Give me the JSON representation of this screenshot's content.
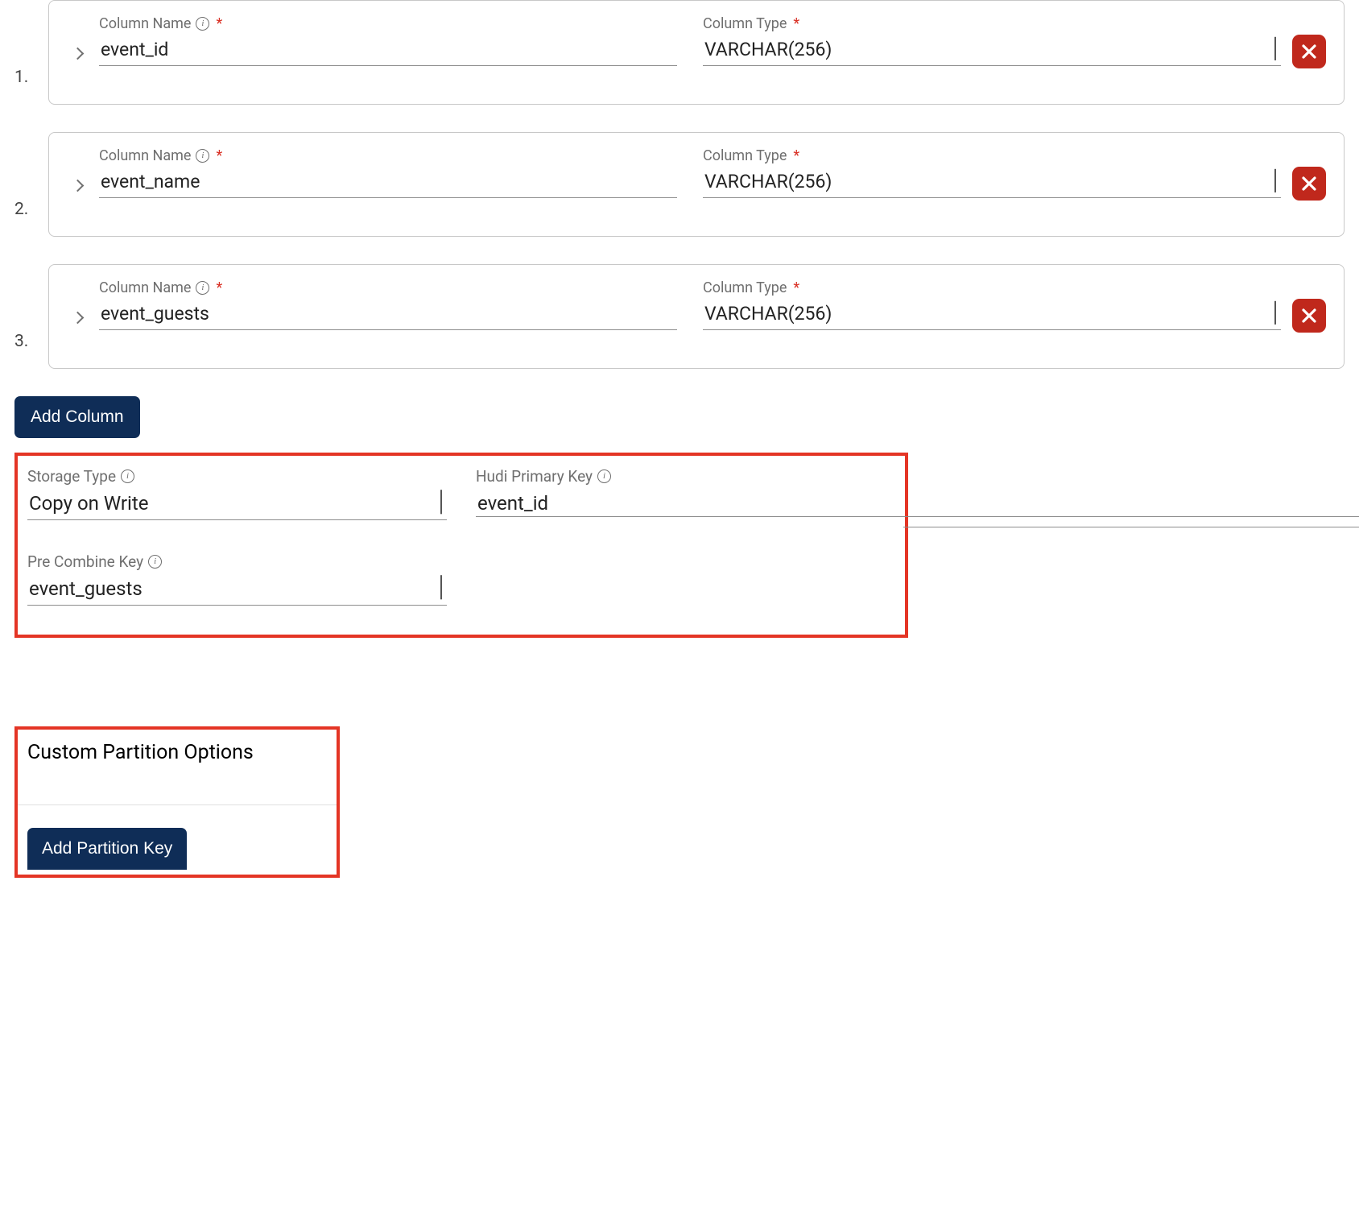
{
  "labels": {
    "column_name": "Column Name",
    "column_type": "Column Type",
    "info_glyph": "i"
  },
  "columns": [
    {
      "index": "1.",
      "name": "event_id",
      "type": "VARCHAR(256)"
    },
    {
      "index": "2.",
      "name": "event_name",
      "type": "VARCHAR(256)"
    },
    {
      "index": "3.",
      "name": "event_guests",
      "type": "VARCHAR(256)"
    }
  ],
  "add_column_btn": "Add Column",
  "storage": {
    "storage_type_label": "Storage Type",
    "storage_type_value": "Copy on Write",
    "hudi_pk_label": "Hudi Primary Key",
    "hudi_pk_value": "event_id",
    "pre_combine_label": "Pre Combine Key",
    "pre_combine_value": "event_guests"
  },
  "partition": {
    "title": "Custom Partition Options",
    "add_btn": "Add Partition Key"
  }
}
